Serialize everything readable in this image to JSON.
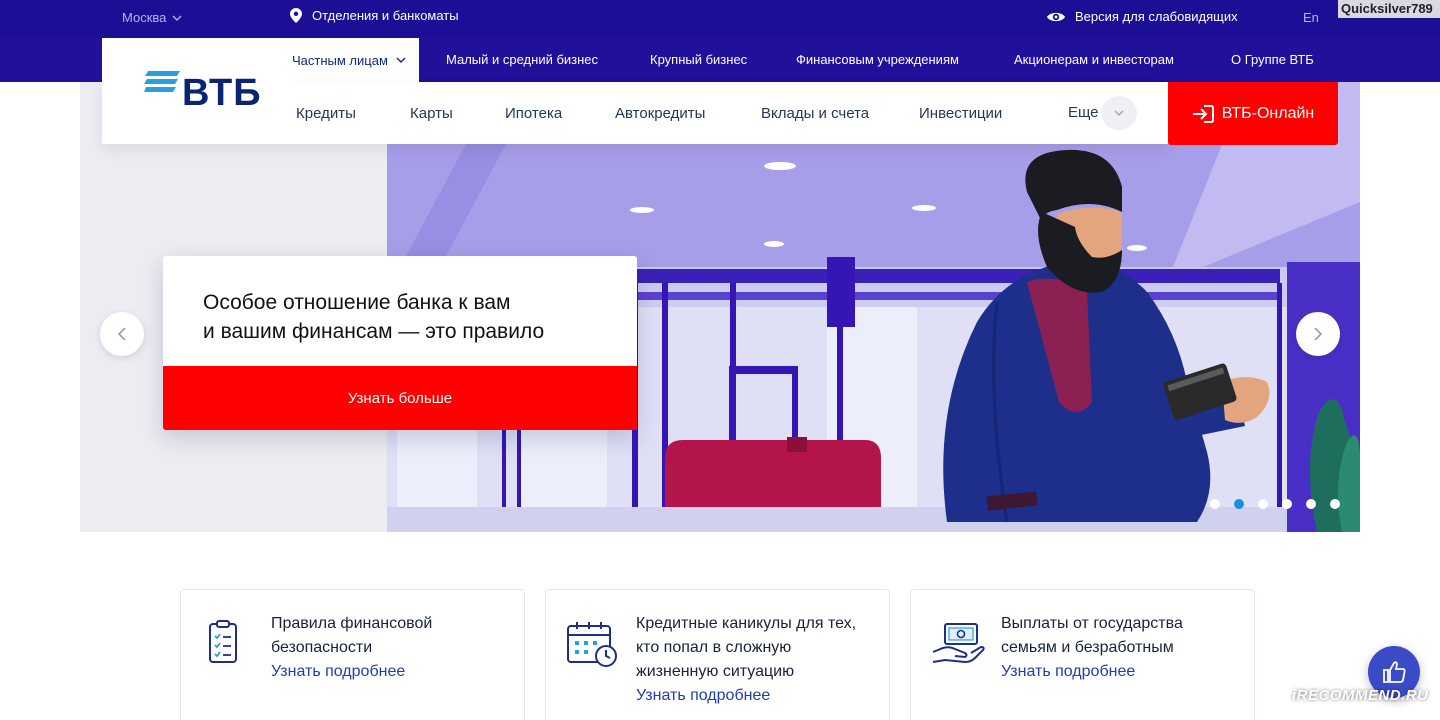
{
  "topbar": {
    "city": "Москва",
    "branches": "Отделения и банкоматы",
    "vision": "Версия для слабовидящих",
    "lang": "En",
    "watermark": "Quicksilver789"
  },
  "segments": {
    "items": [
      {
        "label": "Частным лицам"
      },
      {
        "label": "Малый и средний бизнес"
      },
      {
        "label": "Крупный бизнес"
      },
      {
        "label": "Финансовым учреждениям"
      },
      {
        "label": "Акционерам и инвесторам"
      },
      {
        "label": "О Группе ВТБ"
      }
    ]
  },
  "brand": {
    "name": "ВТБ",
    "color": "#0a2373"
  },
  "nav": {
    "items": [
      {
        "label": "Кредиты"
      },
      {
        "label": "Карты"
      },
      {
        "label": "Ипотека"
      },
      {
        "label": "Автокредиты"
      },
      {
        "label": "Вклады и счета"
      },
      {
        "label": "Инвестиции"
      }
    ],
    "more": "Еще",
    "online": "ВТБ-Онлайн"
  },
  "hero": {
    "title_line1": "Особое отношение банка к вам",
    "title_line2": "и вашим финансам — это правило",
    "cta": "Узнать больше",
    "slides_total": 6,
    "active_slide": 2
  },
  "cards": [
    {
      "icon": "checklist-icon",
      "title": "Правила финансовой безопасности",
      "link": "Узнать подробнее"
    },
    {
      "icon": "calendar-clock-icon",
      "title": "Кредитные каникулы для тех, кто попал в сложную жизненную ситуацию",
      "link": "Узнать подробнее"
    },
    {
      "icon": "money-hand-icon",
      "title": "Выплаты от государства семьям и безработным",
      "link": "Узнать подробнее"
    }
  ],
  "watermark_site": "iRECOMMEND.RU",
  "colors": {
    "top_bg": "#1d0f95",
    "accent_red": "#ff0000",
    "link_blue": "#1e3fb0"
  }
}
